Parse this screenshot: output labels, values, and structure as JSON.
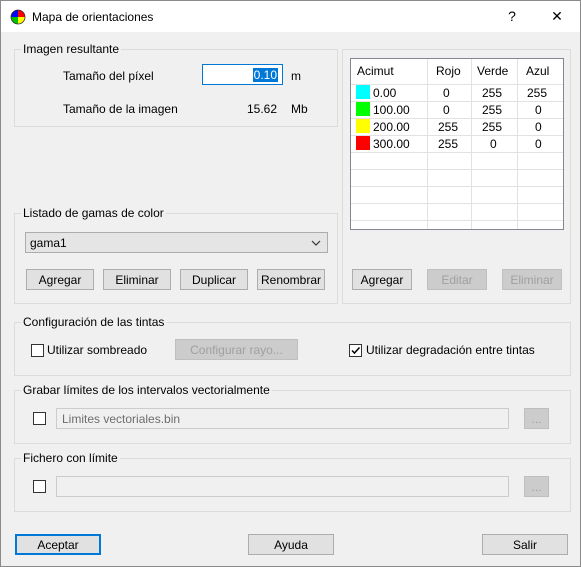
{
  "window": {
    "title": "Mapa de orientaciones",
    "help_label": "?",
    "close_label": "✕"
  },
  "imagen": {
    "legend": "Imagen resultante",
    "pixel_label": "Tamaño del píxel",
    "pixel_value": "0.10",
    "pixel_unit": "m",
    "image_size_label": "Tamaño de la imagen",
    "image_size_value": "15.62",
    "image_size_unit": "Mb"
  },
  "table": {
    "headers": [
      "Acimut",
      "Rojo",
      "Verde",
      "Azul"
    ],
    "rows": [
      {
        "acimut": "0.00",
        "rojo": "0",
        "verde": "255",
        "azul": "255",
        "color": "#00ffff"
      },
      {
        "acimut": "100.00",
        "rojo": "0",
        "verde": "255",
        "azul": "0",
        "color": "#00ff00"
      },
      {
        "acimut": "200.00",
        "rojo": "255",
        "verde": "255",
        "azul": "0",
        "color": "#ffff00"
      },
      {
        "acimut": "300.00",
        "rojo": "255",
        "verde": "0",
        "azul": "0",
        "color": "#ff0000"
      }
    ],
    "agregar": "Agregar",
    "editar": "Editar",
    "eliminar": "Eliminar"
  },
  "gamas": {
    "legend": "Listado de gamas de color",
    "selected": "gama1",
    "agregar": "Agregar",
    "eliminar": "Eliminar",
    "duplicar": "Duplicar",
    "renombrar": "Renombrar"
  },
  "tintas": {
    "legend": "Configuración de las tintas",
    "sombreado_label": "Utilizar sombreado",
    "sombreado_checked": false,
    "configurar_label": "Configurar rayo...",
    "degradacion_label": "Utilizar degradación entre tintas",
    "degradacion_checked": true
  },
  "grabar": {
    "legend": "Grabar límites de los intervalos vectorialmente",
    "checked": false,
    "value": "Limites vectoriales.bin",
    "browse": "..."
  },
  "fichero": {
    "legend": "Fichero con límite",
    "checked": false,
    "value": "",
    "browse": "..."
  },
  "footer": {
    "aceptar": "Aceptar",
    "ayuda": "Ayuda",
    "salir": "Salir"
  },
  "colors": {
    "focus_border": "#0078d7",
    "selection": "#0078d7"
  }
}
